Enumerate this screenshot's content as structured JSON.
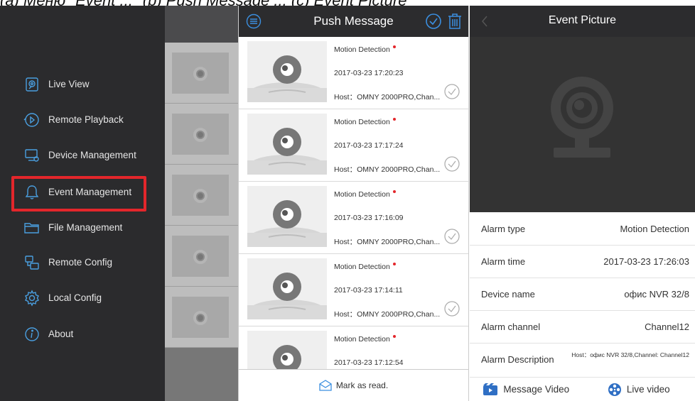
{
  "caption_fragment": "(a) Меню \"Event ...\"  (b) Push Message ...  (c) Event Picture",
  "menu": {
    "items": [
      {
        "label": "Live View",
        "icon": "camera-icon"
      },
      {
        "label": "Remote Playback",
        "icon": "playback-icon"
      },
      {
        "label": "Device Management",
        "icon": "device-icon"
      },
      {
        "label": "Event Management",
        "icon": "bell-icon"
      },
      {
        "label": "File Management",
        "icon": "folder-icon"
      },
      {
        "label": "Remote Config",
        "icon": "remote-config-icon"
      },
      {
        "label": "Local Config",
        "icon": "gear-icon"
      },
      {
        "label": "About",
        "icon": "info-icon"
      }
    ],
    "highlighted": "Event Management",
    "highlight_color": "#e3262b"
  },
  "push": {
    "title": "Push Message",
    "messages": [
      {
        "type": "Motion Detection",
        "time": "2017-03-23 17:20:23",
        "host": "Host：OMNY 2000PRO,Chan..."
      },
      {
        "type": "Motion Detection",
        "time": "2017-03-23 17:17:24",
        "host": "Host：OMNY 2000PRO,Chan..."
      },
      {
        "type": "Motion Detection",
        "time": "2017-03-23 17:16:09",
        "host": "Host：OMNY 2000PRO,Chan..."
      },
      {
        "type": "Motion Detection",
        "time": "2017-03-23 17:14:11",
        "host": "Host：OMNY 2000PRO,Chan..."
      },
      {
        "type": "Motion Detection",
        "time": "2017-03-23 17:12:54",
        "host": ""
      }
    ],
    "footer": "Mark as read.",
    "accent": "#1e88e5"
  },
  "event": {
    "title": "Event Picture",
    "rows": [
      {
        "key": "Alarm type",
        "value": "Motion Detection"
      },
      {
        "key": "Alarm time",
        "value": "2017-03-23 17:26:03"
      },
      {
        "key": "Device name",
        "value": "офис NVR 32/8"
      },
      {
        "key": "Alarm channel",
        "value": "Channel12"
      },
      {
        "key": "Alarm Description",
        "value": "Host：офис NVR 32/8,Channel: Channel12"
      }
    ],
    "message_video": "Message Video",
    "live_video": "Live video"
  }
}
